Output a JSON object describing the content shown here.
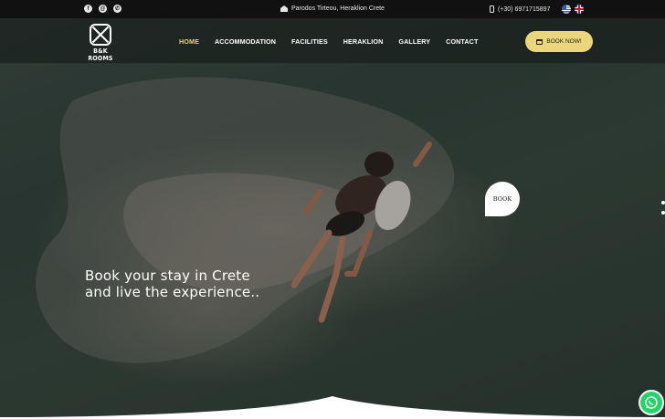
{
  "topbar": {
    "social_icons": [
      "facebook-icon",
      "email-icon",
      "viber-icon"
    ],
    "address": "Parodos Tirteou, Heraklion Crete",
    "phone": "(+30) 6971715897",
    "languages": [
      "greek-flag-icon",
      "english-flag-icon"
    ]
  },
  "brand": {
    "logo_text": "B&K ROOMS"
  },
  "nav": {
    "items": [
      {
        "label": "HOME",
        "active": true
      },
      {
        "label": "ACCOMMODATION",
        "active": false
      },
      {
        "label": "FACILITIES",
        "active": false
      },
      {
        "label": "HERAKLION",
        "active": false
      },
      {
        "label": "GALLERY",
        "active": false
      },
      {
        "label": "CONTACT",
        "active": false
      }
    ],
    "cta": "BOOK NOW!"
  },
  "hero": {
    "line1": "Book your stay in Crete",
    "line2": "and live the experience..",
    "book_bubble": "BOOK"
  },
  "colors": {
    "accent": "#ecd67a",
    "active_nav": "#e8cf7a",
    "topbar_bg": "#111111",
    "whatsapp": "#25d366"
  }
}
